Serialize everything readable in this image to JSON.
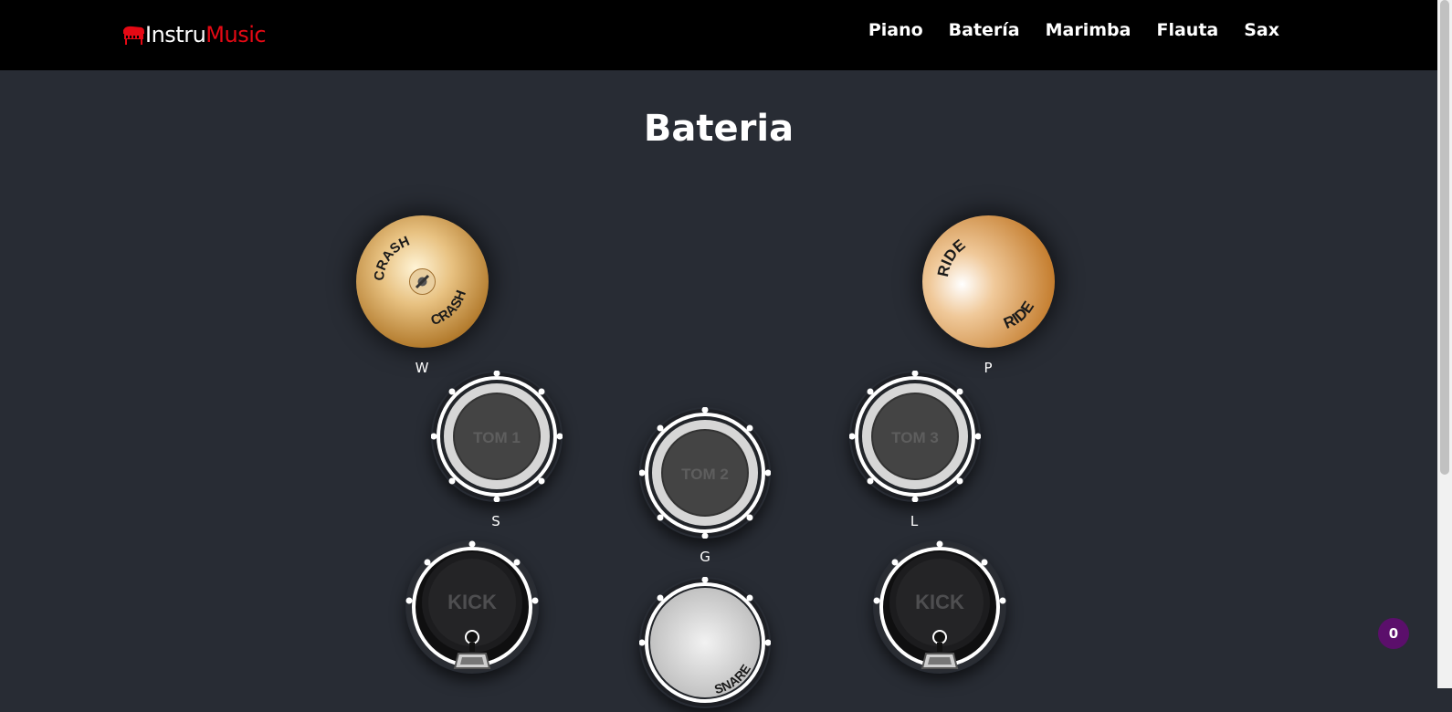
{
  "brand": {
    "part1": "Instru",
    "part2": "Music"
  },
  "nav": {
    "items": [
      "Piano",
      "Batería",
      "Marimba",
      "Flauta",
      "Sax"
    ]
  },
  "page": {
    "title": "Bateria"
  },
  "pads": {
    "crash": {
      "label": "CRASH",
      "key": "W"
    },
    "ride": {
      "label": "RIDE",
      "key": "P"
    },
    "tom1": {
      "label": "TOM 1",
      "key": "S"
    },
    "tom2": {
      "label": "TOM 2",
      "key": "G"
    },
    "tom3": {
      "label": "TOM 3",
      "key": "L"
    },
    "kick_left": {
      "label": "KICK"
    },
    "kick_right": {
      "label": "KICK"
    },
    "snare": {
      "label": "SNARE"
    }
  },
  "counter": {
    "value": "0"
  },
  "colors": {
    "accent": "#e50914",
    "background": "#282c34",
    "navbar": "#000000",
    "counter_bg": "#5b0f6b"
  }
}
